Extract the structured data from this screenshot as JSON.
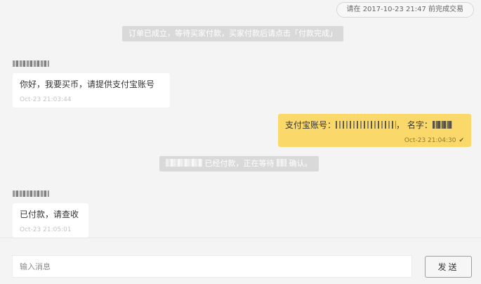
{
  "header": {
    "deadline": "请在 2017-10-23 21:47 前完成交易"
  },
  "messages": {
    "system_1": "订单已成立，等待买家付款，买家付款后请点击「付款完成」",
    "system_2_middle": "已经付款，正在等待",
    "system_2_end": "确认。",
    "m1_text": "你好，我要买币，请提供支付宝账号",
    "m1_time": "Oct-23 21:03:44",
    "m2_label_account": "支付宝账号：",
    "m2_label_name": "，  名字：",
    "m2_time": "Oct-23 21:04:30",
    "m2_check": "✔",
    "m3_text": "已付款，请查收",
    "m3_time": "Oct-23 21:05:01"
  },
  "composer": {
    "placeholder": "输入消息",
    "send_label": "发送"
  },
  "colors": {
    "own_bubble": "#fad96a",
    "system_bg": "#d9d9d9",
    "page_bg": "#f4f4f4"
  }
}
